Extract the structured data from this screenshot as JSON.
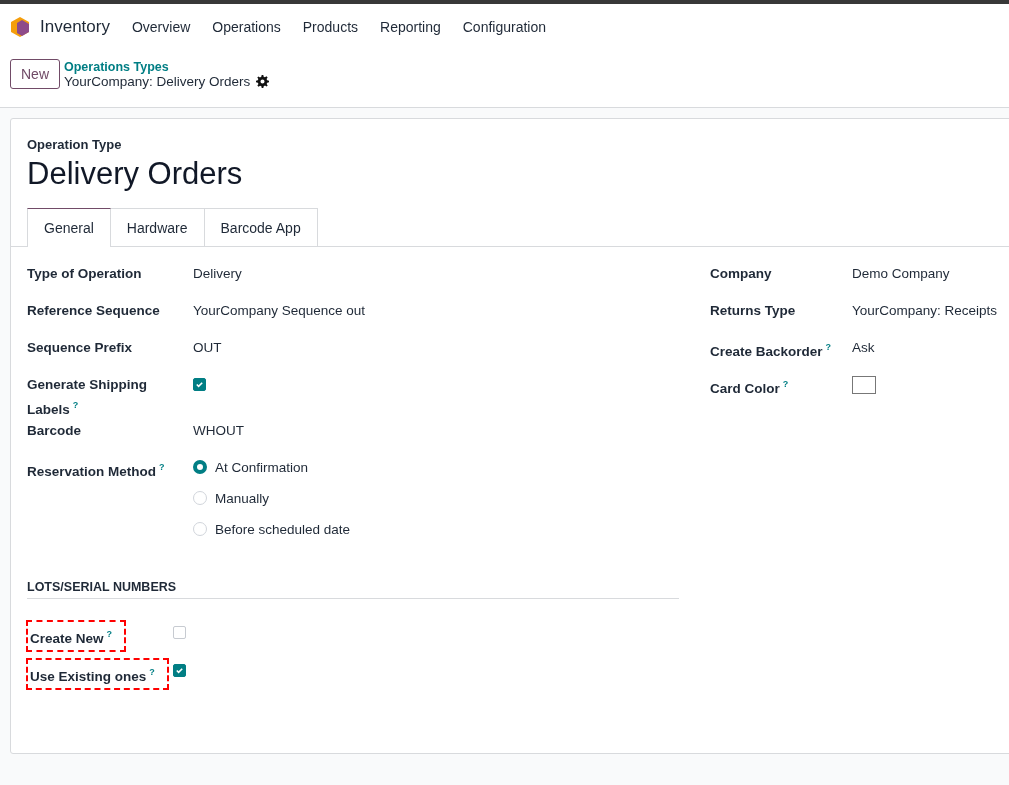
{
  "navbar": {
    "app_name": "Inventory",
    "menu": [
      "Overview",
      "Operations",
      "Products",
      "Reporting",
      "Configuration"
    ]
  },
  "control_panel": {
    "new_button": "New",
    "breadcrumb": "Operations Types",
    "record_title": "YourCompany: Delivery Orders"
  },
  "form": {
    "subtitle": "Operation Type",
    "title": "Delivery Orders",
    "tabs": [
      {
        "label": "General",
        "selected": true
      },
      {
        "label": "Hardware",
        "selected": false
      },
      {
        "label": "Barcode App",
        "selected": false
      }
    ],
    "left_fields": [
      {
        "label": "Type of Operation",
        "kind": "text",
        "value": "Delivery"
      },
      {
        "label": "Reference Sequence",
        "kind": "text",
        "value": "YourCompany Sequence out"
      },
      {
        "label": "Sequence Prefix",
        "kind": "text",
        "value": "OUT"
      },
      {
        "label": "Generate Shipping Labels",
        "help": "?",
        "kind": "checkbox",
        "checked": true
      },
      {
        "label": "Barcode",
        "kind": "text",
        "value": "WHOUT"
      },
      {
        "label": "Reservation Method",
        "help": "?",
        "kind": "radio",
        "options": [
          {
            "label": "At Confirmation",
            "selected": true
          },
          {
            "label": "Manually",
            "selected": false
          },
          {
            "label": "Before scheduled date",
            "selected": false
          }
        ]
      }
    ],
    "right_fields": [
      {
        "label": "Company",
        "kind": "text",
        "value": "Demo Company"
      },
      {
        "label": "Returns Type",
        "kind": "text",
        "value": "YourCompany: Receipts"
      },
      {
        "label": "Create Backorder",
        "help": "?",
        "kind": "text",
        "value": "Ask"
      },
      {
        "label": "Card Color",
        "help": "?",
        "kind": "color",
        "color": "#ffffff"
      }
    ],
    "section": {
      "title": "LOTS/SERIAL NUMBERS",
      "fields": [
        {
          "label": "Create New",
          "help": "?",
          "kind": "checkbox",
          "checked": false,
          "highlighted": true
        },
        {
          "label": "Use Existing ones",
          "help": "?",
          "kind": "checkbox",
          "checked": true,
          "highlighted": true
        }
      ]
    }
  }
}
